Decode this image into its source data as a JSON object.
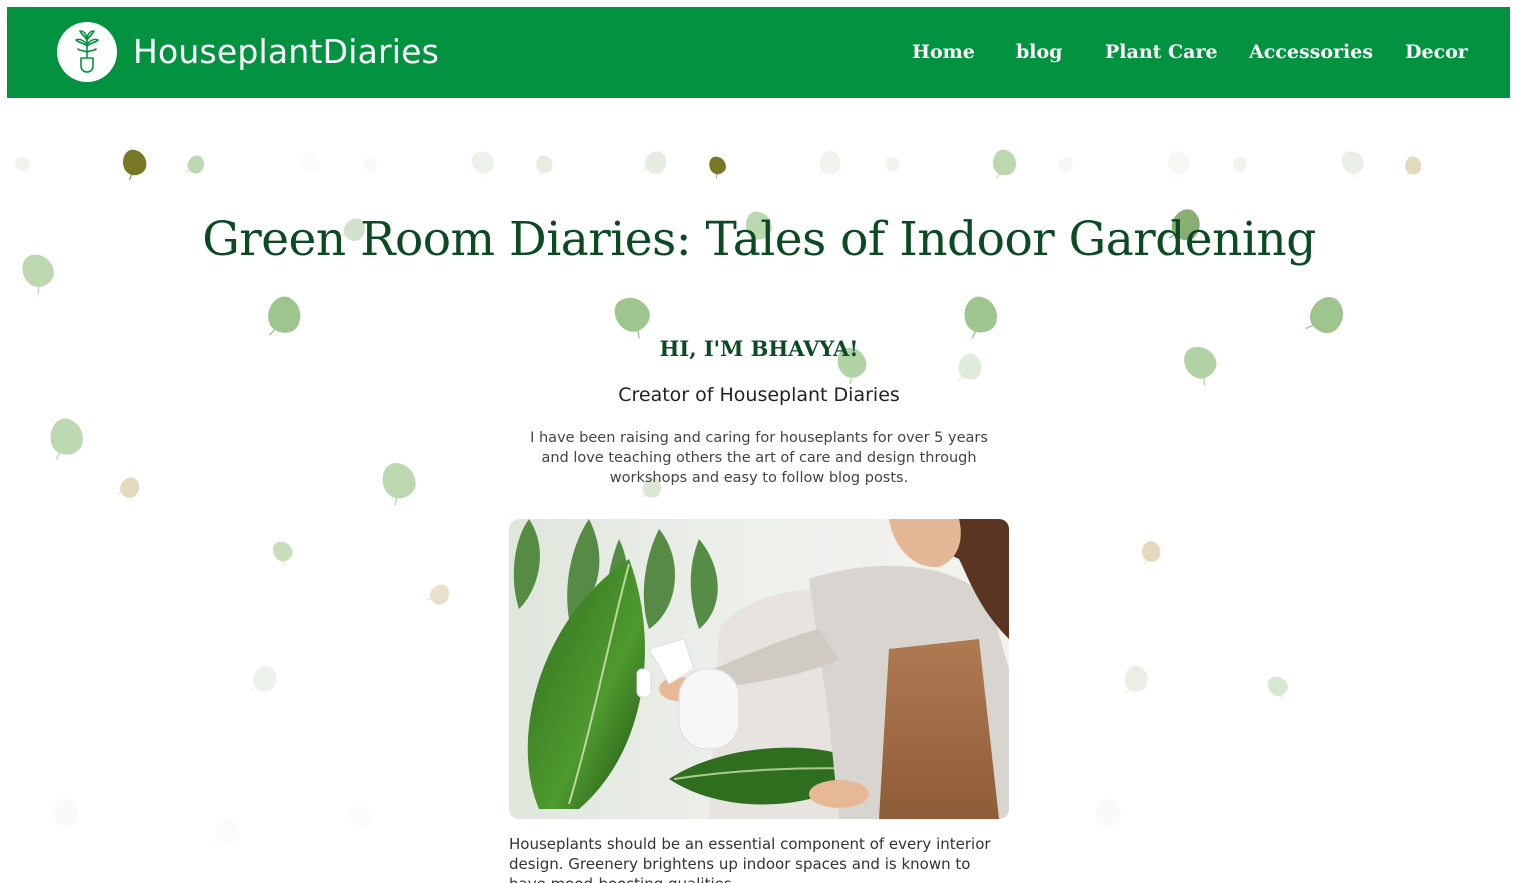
{
  "header": {
    "brand": "HouseplantDiaries",
    "logo_icon": "plant-shovel-icon",
    "nav": [
      {
        "label": "Home"
      },
      {
        "label": "blog"
      },
      {
        "label": "Plant Care"
      },
      {
        "label": "Accessories"
      },
      {
        "label": "Decor"
      }
    ]
  },
  "hero": {
    "title": "Green Room Diaries: Tales of Indoor Gardening"
  },
  "intro": {
    "heading": "HI, I'M BHAVYA!",
    "subtitle": "Creator of Houseplant Diaries",
    "paragraph": "I have been raising and caring for houseplants for over 5 years and love teaching others the art of care and design through workshops and easy to follow blog posts.",
    "photo_icon": "woman-watering-plant-photo"
  },
  "article": {
    "paragraph": "Houseplants should be an essential component of every interior design. Greenery brightens up indoor spaces and is known to have mood-boosting qualities."
  },
  "colors": {
    "brand_green": "#039340",
    "heading_green": "#0b4a23",
    "leaf_green": "#7fb26a"
  }
}
